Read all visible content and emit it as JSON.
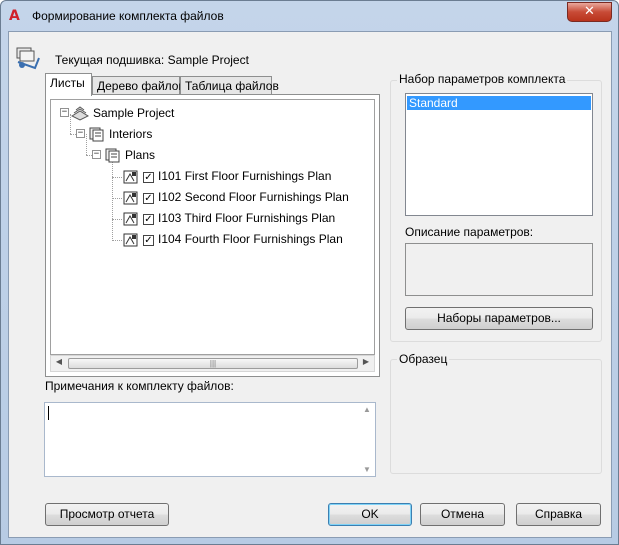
{
  "window": {
    "title": "Формирование комплекта файлов",
    "close_glyph": "✕",
    "app_icon_glyph": "A",
    "app_icon": "autocad-icon",
    "accent_color": "#d0202a"
  },
  "current_sheetset": "Текущая подшивка: Sample Project",
  "tabs": [
    {
      "label": "Листы",
      "active": true
    },
    {
      "label": "Дерево файлов",
      "active": false
    },
    {
      "label": "Таблица файлов",
      "active": false
    }
  ],
  "tree": {
    "root": {
      "label": "Sample Project",
      "expanded": true
    },
    "subset": {
      "label": "Interiors",
      "expanded": true
    },
    "subsubset": {
      "label": "Plans",
      "expanded": true
    },
    "sheets": [
      {
        "label": "I101 First Floor Furnishings Plan",
        "checked": true
      },
      {
        "label": "I102 Second Floor Furnishings Plan",
        "checked": true
      },
      {
        "label": "I103 Third Floor Furnishings Plan",
        "checked": true
      },
      {
        "label": "I104 Fourth Floor Furnishings Plan",
        "checked": true
      }
    ],
    "expander_glyph": "−",
    "check_glyph": "✓"
  },
  "notes": {
    "label": "Примечания к комплекту файлов:",
    "value": ""
  },
  "setup": {
    "group_label": "Набор параметров комплекта",
    "items": [
      "Standard"
    ],
    "selected": "Standard",
    "description_label": "Описание параметров:",
    "description_value": "",
    "setups_button": "Наборы параметров..."
  },
  "preview": {
    "group_label": "Образец"
  },
  "buttons": {
    "view_report": "Просмотр отчета",
    "ok": "OK",
    "cancel": "Отмена",
    "help": "Справка"
  },
  "colors": {
    "selection": "#3399ff",
    "close_button": "#c84b36"
  }
}
